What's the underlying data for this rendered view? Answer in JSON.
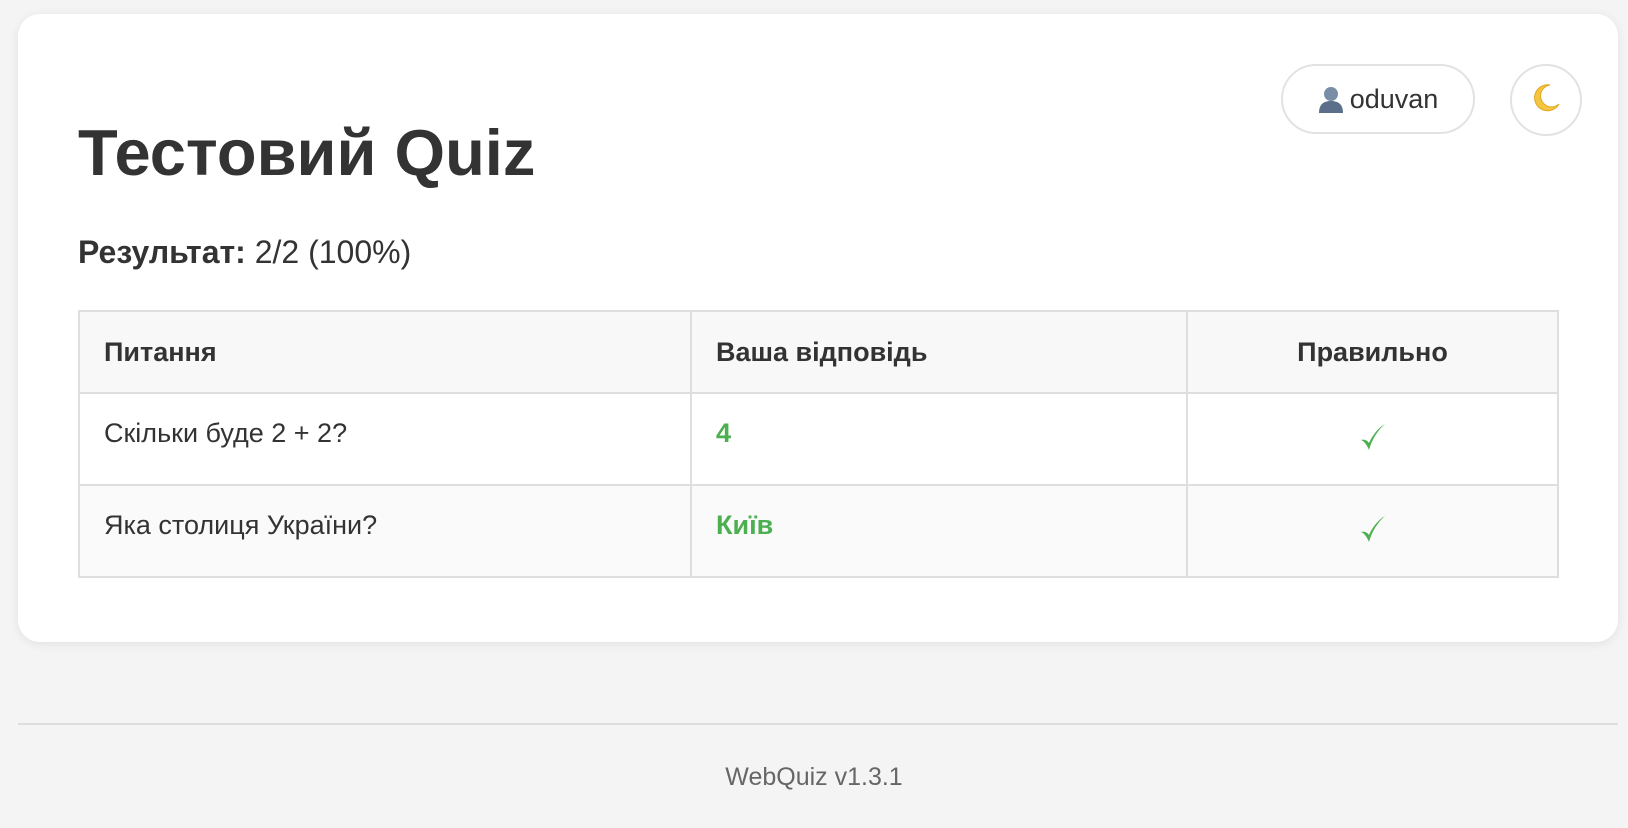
{
  "user": {
    "name": "oduvan",
    "icon": "user-icon"
  },
  "theme_toggle": {
    "icon": "moon-icon"
  },
  "quiz": {
    "title": "Тестовий Quiz",
    "result_label": "Результат:",
    "result_value": "2/2 (100%)"
  },
  "table": {
    "headers": [
      "Питання",
      "Ваша відповідь",
      "Правильно"
    ],
    "rows": [
      {
        "question": "Скільки буде 2 + 2?",
        "answer": "4",
        "correct": true,
        "correct_icon": "check-icon"
      },
      {
        "question": "Яка столиця України?",
        "answer": "Київ",
        "correct": true,
        "correct_icon": "check-icon"
      }
    ]
  },
  "footer": {
    "text": "WebQuiz v1.3.1"
  },
  "colors": {
    "correct": "#4caf50",
    "text": "#333333",
    "background": "#f4f4f4"
  }
}
